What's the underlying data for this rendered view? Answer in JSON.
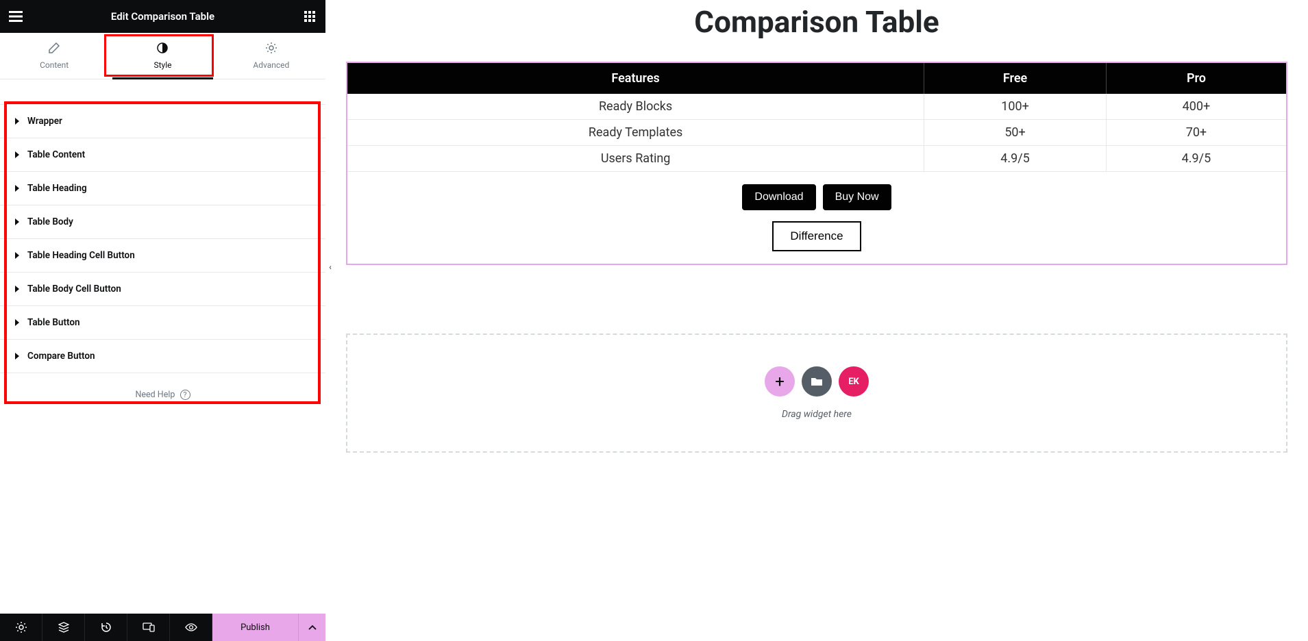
{
  "topbar": {
    "title": "Edit Comparison Table"
  },
  "tabs": {
    "content": "Content",
    "style": "Style",
    "advanced": "Advanced"
  },
  "sections": [
    "Wrapper",
    "Table Content",
    "Table Heading",
    "Table Body",
    "Table Heading Cell Button",
    "Table Body Cell Button",
    "Table Button",
    "Compare Button"
  ],
  "help": {
    "text": "Need Help"
  },
  "bottombar": {
    "publish": "Publish"
  },
  "canvas": {
    "title": "Comparison Table",
    "headers": [
      "Features",
      "Free",
      "Pro"
    ],
    "rows": [
      [
        "Ready Blocks",
        "100+",
        "400+"
      ],
      [
        "Ready Templates",
        "50+",
        "70+"
      ],
      [
        "Users Rating",
        "4.9/5",
        "4.9/5"
      ]
    ],
    "download": "Download",
    "buy": "Buy Now",
    "diff": "Difference",
    "dropText": "Drag widget here",
    "ekLabel": "EK"
  }
}
